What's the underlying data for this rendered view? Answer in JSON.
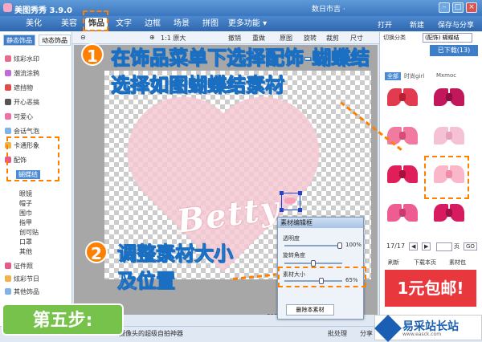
{
  "window": {
    "title": "美图秀秀 3.9.0",
    "news": "数日市吉 ·"
  },
  "menu": {
    "tabs": [
      "美化",
      "美容",
      "饰品",
      "文字",
      "边框",
      "场景",
      "拼图",
      "更多功能 ▾"
    ],
    "active": "饰品"
  },
  "right_tools": [
    "打开",
    "新建",
    "保存与分享"
  ],
  "toolbar": {
    "zoom_label": "1:1 原大",
    "items": [
      "撤销",
      "重做",
      "原图",
      "旋转",
      "裁剪",
      "尺寸"
    ],
    "category_label": "切换分类",
    "category_value": "(配饰) 蝴蝶结"
  },
  "left_panel": {
    "tabs": [
      "静态饰品",
      "动态饰品"
    ],
    "items": [
      {
        "label": "炫彩水印",
        "color": "#e86b8e"
      },
      {
        "label": "潮流涂鸦",
        "color": "#c06bd6"
      },
      {
        "label": "遮挡物",
        "color": "#e34b4b"
      },
      {
        "label": "开心恶搞",
        "color": "#555555"
      },
      {
        "label": "可爱心",
        "color": "#f06fa6"
      },
      {
        "label": "会话气泡",
        "color": "#7fb2e8"
      },
      {
        "label": "卡通形象",
        "color": "#f0b24b"
      },
      {
        "label": "配饰",
        "color": "#e35a8b"
      }
    ],
    "sub_selected": "蝴蝶结",
    "sub_items": [
      "眼镜",
      "帽子",
      "围巾",
      "指甲",
      "创可贴",
      "口罩",
      "其他"
    ],
    "bottom_items": [
      {
        "label": "证件照",
        "color": "#e35a8b"
      },
      {
        "label": "炫彩节日",
        "color": "#f0b24b"
      },
      {
        "label": "其他饰品",
        "color": "#7fb2e8"
      }
    ]
  },
  "canvas": {
    "betty_text": "Betty",
    "size_readout": "600"
  },
  "dialog": {
    "title": "素材编辑框",
    "opacity_label": "透明度",
    "opacity_value": "100%",
    "opacity": 1.0,
    "rotate_label": "旋转角度",
    "size_label": "素材大小",
    "size_value": "65%",
    "size": 0.65,
    "delete_button": "删除本素材"
  },
  "right_panel": {
    "download_button": "已下载(13)",
    "tabs": [
      "全部",
      "时尚girl",
      "Mxmoc"
    ],
    "page_text": "17/17",
    "page_input": "页",
    "go_button": "GO",
    "refresh_button": "刷新",
    "download_page_button": "下载本页",
    "pack_button": "素材包",
    "promo": "1元包邮!",
    "bows": [
      {
        "color": "#e23a4f",
        "center": "#b81f33"
      },
      {
        "color": "#c2185b",
        "center": "#8e0f41"
      },
      {
        "color": "#f07aa0",
        "center": "#d84a7a"
      },
      {
        "color": "#f4c2d4",
        "center": "#e8a0b8"
      },
      {
        "color": "#e01e5a",
        "center": "#a80f3f"
      },
      {
        "color": "#f9b7c9",
        "center": "#f08aa8"
      },
      {
        "color": "#ee5d92",
        "center": "#c93a6e"
      },
      {
        "color": "#d81b60",
        "center": "#a01045"
      }
    ]
  },
  "status": {
    "hint": "摄像头的超级自拍神器",
    "batch": "批处理",
    "share": "分享"
  },
  "overlay": {
    "step1_num": "1",
    "step1_line1": "在饰品菜单下选择配饰-蝴蝶结",
    "step1_line2": "选择如图蝴蝶结素材",
    "step2_num": "2",
    "step2_line1": "调整素材大小",
    "step2_line2": "及位置",
    "step_label": "第五步:"
  },
  "watermark": {
    "title": "易采站长站",
    "sub": "www.easck.com"
  }
}
